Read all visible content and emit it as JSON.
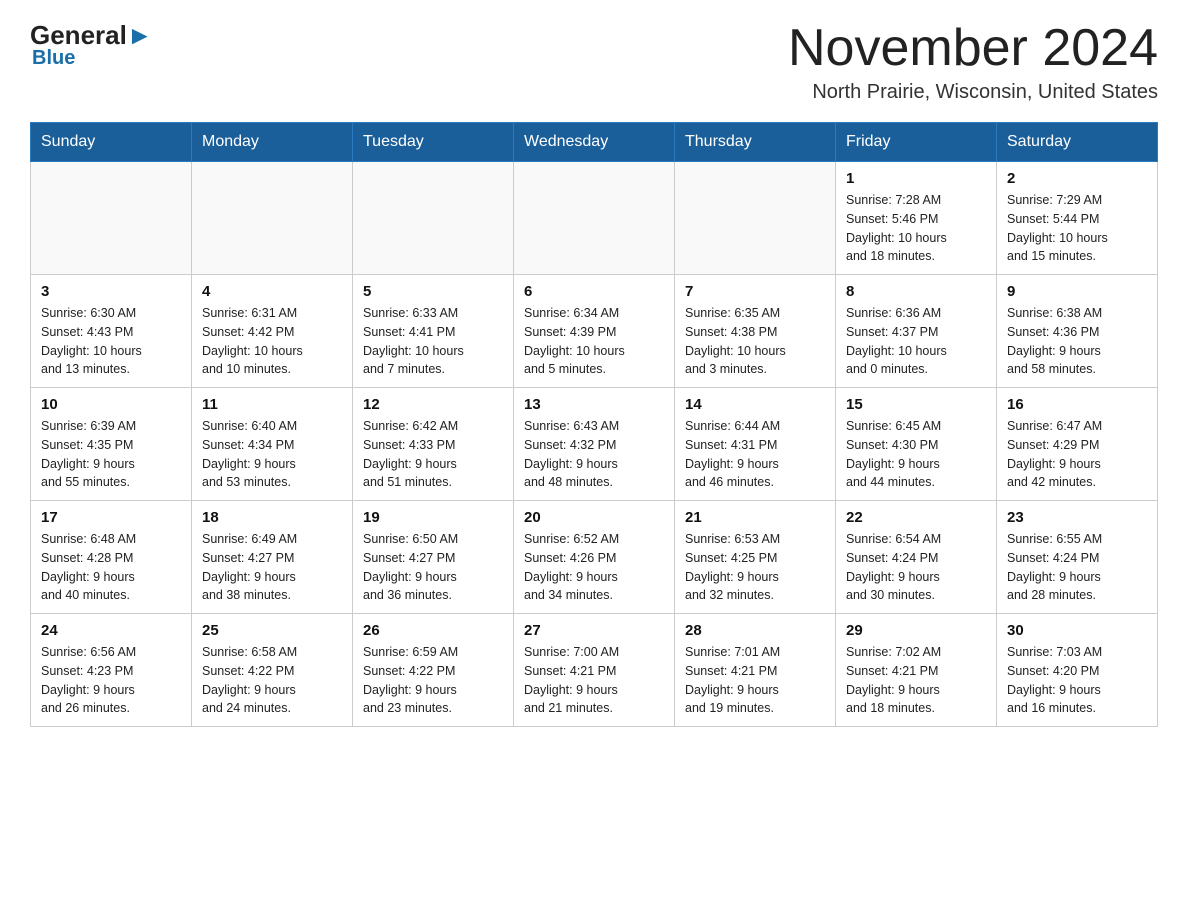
{
  "header": {
    "logo_general": "General",
    "logo_blue": "Blue",
    "month_title": "November 2024",
    "location": "North Prairie, Wisconsin, United States"
  },
  "days_of_week": [
    "Sunday",
    "Monday",
    "Tuesday",
    "Wednesday",
    "Thursday",
    "Friday",
    "Saturday"
  ],
  "weeks": [
    [
      {
        "day": "",
        "info": ""
      },
      {
        "day": "",
        "info": ""
      },
      {
        "day": "",
        "info": ""
      },
      {
        "day": "",
        "info": ""
      },
      {
        "day": "",
        "info": ""
      },
      {
        "day": "1",
        "info": "Sunrise: 7:28 AM\nSunset: 5:46 PM\nDaylight: 10 hours\nand 18 minutes."
      },
      {
        "day": "2",
        "info": "Sunrise: 7:29 AM\nSunset: 5:44 PM\nDaylight: 10 hours\nand 15 minutes."
      }
    ],
    [
      {
        "day": "3",
        "info": "Sunrise: 6:30 AM\nSunset: 4:43 PM\nDaylight: 10 hours\nand 13 minutes."
      },
      {
        "day": "4",
        "info": "Sunrise: 6:31 AM\nSunset: 4:42 PM\nDaylight: 10 hours\nand 10 minutes."
      },
      {
        "day": "5",
        "info": "Sunrise: 6:33 AM\nSunset: 4:41 PM\nDaylight: 10 hours\nand 7 minutes."
      },
      {
        "day": "6",
        "info": "Sunrise: 6:34 AM\nSunset: 4:39 PM\nDaylight: 10 hours\nand 5 minutes."
      },
      {
        "day": "7",
        "info": "Sunrise: 6:35 AM\nSunset: 4:38 PM\nDaylight: 10 hours\nand 3 minutes."
      },
      {
        "day": "8",
        "info": "Sunrise: 6:36 AM\nSunset: 4:37 PM\nDaylight: 10 hours\nand 0 minutes."
      },
      {
        "day": "9",
        "info": "Sunrise: 6:38 AM\nSunset: 4:36 PM\nDaylight: 9 hours\nand 58 minutes."
      }
    ],
    [
      {
        "day": "10",
        "info": "Sunrise: 6:39 AM\nSunset: 4:35 PM\nDaylight: 9 hours\nand 55 minutes."
      },
      {
        "day": "11",
        "info": "Sunrise: 6:40 AM\nSunset: 4:34 PM\nDaylight: 9 hours\nand 53 minutes."
      },
      {
        "day": "12",
        "info": "Sunrise: 6:42 AM\nSunset: 4:33 PM\nDaylight: 9 hours\nand 51 minutes."
      },
      {
        "day": "13",
        "info": "Sunrise: 6:43 AM\nSunset: 4:32 PM\nDaylight: 9 hours\nand 48 minutes."
      },
      {
        "day": "14",
        "info": "Sunrise: 6:44 AM\nSunset: 4:31 PM\nDaylight: 9 hours\nand 46 minutes."
      },
      {
        "day": "15",
        "info": "Sunrise: 6:45 AM\nSunset: 4:30 PM\nDaylight: 9 hours\nand 44 minutes."
      },
      {
        "day": "16",
        "info": "Sunrise: 6:47 AM\nSunset: 4:29 PM\nDaylight: 9 hours\nand 42 minutes."
      }
    ],
    [
      {
        "day": "17",
        "info": "Sunrise: 6:48 AM\nSunset: 4:28 PM\nDaylight: 9 hours\nand 40 minutes."
      },
      {
        "day": "18",
        "info": "Sunrise: 6:49 AM\nSunset: 4:27 PM\nDaylight: 9 hours\nand 38 minutes."
      },
      {
        "day": "19",
        "info": "Sunrise: 6:50 AM\nSunset: 4:27 PM\nDaylight: 9 hours\nand 36 minutes."
      },
      {
        "day": "20",
        "info": "Sunrise: 6:52 AM\nSunset: 4:26 PM\nDaylight: 9 hours\nand 34 minutes."
      },
      {
        "day": "21",
        "info": "Sunrise: 6:53 AM\nSunset: 4:25 PM\nDaylight: 9 hours\nand 32 minutes."
      },
      {
        "day": "22",
        "info": "Sunrise: 6:54 AM\nSunset: 4:24 PM\nDaylight: 9 hours\nand 30 minutes."
      },
      {
        "day": "23",
        "info": "Sunrise: 6:55 AM\nSunset: 4:24 PM\nDaylight: 9 hours\nand 28 minutes."
      }
    ],
    [
      {
        "day": "24",
        "info": "Sunrise: 6:56 AM\nSunset: 4:23 PM\nDaylight: 9 hours\nand 26 minutes."
      },
      {
        "day": "25",
        "info": "Sunrise: 6:58 AM\nSunset: 4:22 PM\nDaylight: 9 hours\nand 24 minutes."
      },
      {
        "day": "26",
        "info": "Sunrise: 6:59 AM\nSunset: 4:22 PM\nDaylight: 9 hours\nand 23 minutes."
      },
      {
        "day": "27",
        "info": "Sunrise: 7:00 AM\nSunset: 4:21 PM\nDaylight: 9 hours\nand 21 minutes."
      },
      {
        "day": "28",
        "info": "Sunrise: 7:01 AM\nSunset: 4:21 PM\nDaylight: 9 hours\nand 19 minutes."
      },
      {
        "day": "29",
        "info": "Sunrise: 7:02 AM\nSunset: 4:21 PM\nDaylight: 9 hours\nand 18 minutes."
      },
      {
        "day": "30",
        "info": "Sunrise: 7:03 AM\nSunset: 4:20 PM\nDaylight: 9 hours\nand 16 minutes."
      }
    ]
  ]
}
